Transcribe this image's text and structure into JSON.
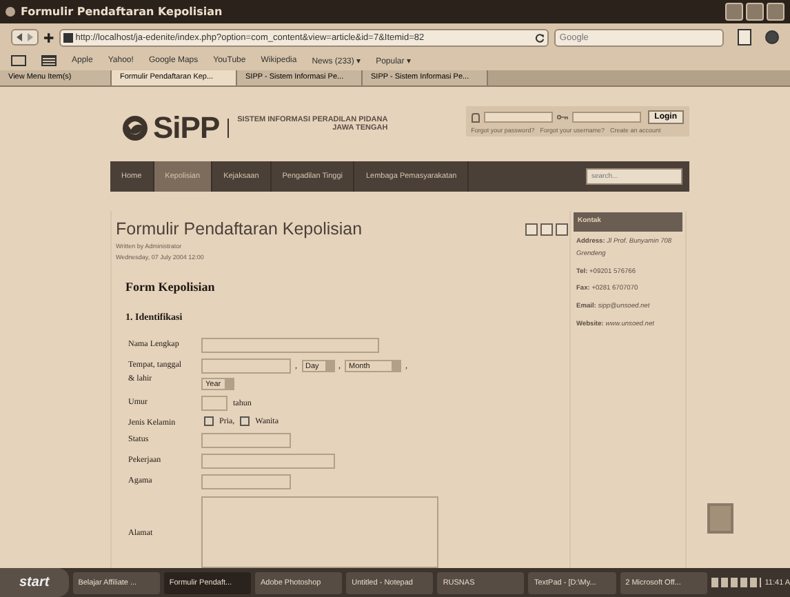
{
  "window": {
    "title": "Formulir Pendaftaran Kepolisian"
  },
  "toolbar": {
    "url": "http://localhost/ja-edenite/index.php?option=com_content&view=article&id=7&Itemid=82",
    "search_placeholder": "Google"
  },
  "bookmarks": [
    "Apple",
    "Yahoo!",
    "Google Maps",
    "YouTube",
    "Wikipedia",
    "News (233) ▾",
    "Popular ▾"
  ],
  "tabs": [
    {
      "label": "View Menu Item(s)",
      "selected": false
    },
    {
      "label": "Formulir Pendaftaran Kep...",
      "selected": true
    },
    {
      "label": "SIPP - Sistem Informasi Pe...",
      "selected": false
    },
    {
      "label": "SIPP - Sistem Informasi Pe...",
      "selected": false
    }
  ],
  "site": {
    "logo": "SiPP",
    "tagline_1": "SISTEM INFORMASI PERADILAN PIDANA",
    "tagline_2": "JAWA TENGAH",
    "login": {
      "button": "Login",
      "links": [
        "Forgot your password?",
        "Forgot your username?",
        "Create an account"
      ]
    },
    "nav": [
      {
        "label": "Home",
        "selected": false
      },
      {
        "label": "Kepolisian",
        "selected": true
      },
      {
        "label": "Kejaksaan",
        "selected": false
      },
      {
        "label": "Pengadilan Tinggi",
        "selected": false
      },
      {
        "label": "Lembaga Pemasyarakatan",
        "selected": false
      }
    ],
    "search_placeholder": "search..."
  },
  "article": {
    "title": "Formulir Pendaftaran Kepolisian",
    "author": "Written by Administrator",
    "date": "Wednesday, 07 July 2004 12:00",
    "form_title": "Form Kepolisian",
    "section": "1. Identifikasi",
    "rows": [
      {
        "kind": "longtext",
        "label": "Nama Lengkap"
      },
      {
        "kind": "date",
        "label": "Tempat, tanggal",
        "label_2": "& lahir",
        "separator": ",",
        "day": "Day",
        "month": "Month",
        "year": "Year"
      },
      {
        "kind": "suffix",
        "label": "Umur",
        "suffix": "tahun"
      },
      {
        "kind": "checks",
        "label": "Jenis Kelamin",
        "options": [
          {
            "label": "Pria,",
            "checked": false
          },
          {
            "label": "Wanita",
            "checked": false
          }
        ]
      },
      {
        "kind": "shorttext",
        "label": "Status"
      },
      {
        "kind": "midtext",
        "label": "Pekerjaan"
      },
      {
        "kind": "shorttext",
        "label": "Agama"
      },
      {
        "kind": "area",
        "label": "Alamat"
      }
    ]
  },
  "sidebar": {
    "title": "Kontak",
    "lines": [
      "**Address:** *Jl Prof. Bunyamin 708 Grendeng*",
      "**Tel:** +09201 576766",
      "**Fax:** +0281 6707070",
      "**Email:** *sipp@unsoed.net*",
      "**Website:** *www.unsoed.net*"
    ]
  },
  "taskbar": {
    "start": "start",
    "items": [
      "Belajar Affiliate ...",
      "Formulir Pendaft...",
      "Adobe Photoshop",
      "Untitled - Notepad",
      "RUSNAS",
      "TextPad - [D:\\My...",
      "2 Microsoft Off..."
    ],
    "clock": "11:41 A"
  }
}
